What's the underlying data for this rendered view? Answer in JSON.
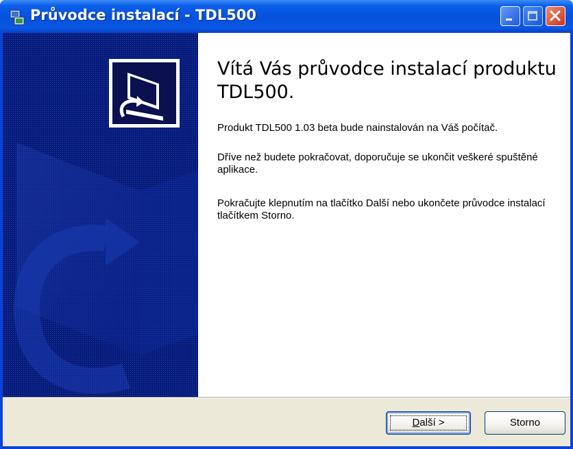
{
  "window": {
    "title": "Průvodce instalací - TDL500",
    "controls": [
      "minimize-icon",
      "maximize-icon",
      "close-icon"
    ]
  },
  "welcome": {
    "heading": "Vítá Vás průvodce instalací produktu TDL500.",
    "paragraph1": "Produkt TDL500 1.03 beta bude nainstalován na Váš počítač.",
    "paragraph2": "Dříve než budete pokračovat, doporučuje se ukončit veškeré spuštěné aplikace.",
    "paragraph3": "Pokračujte klepnutím na tlačítko Další nebo ukončete průvodce instalací tlačítkem Storno."
  },
  "buttons": {
    "next_label": "Další >",
    "next_mnemonic": "D",
    "next_rest": "alší >",
    "cancel_label": "Storno"
  },
  "colors": {
    "title_bar": "#0651dc",
    "side_panel": "#061a78",
    "dialog_face": "#ece9d8",
    "close_button": "#c8361c"
  }
}
